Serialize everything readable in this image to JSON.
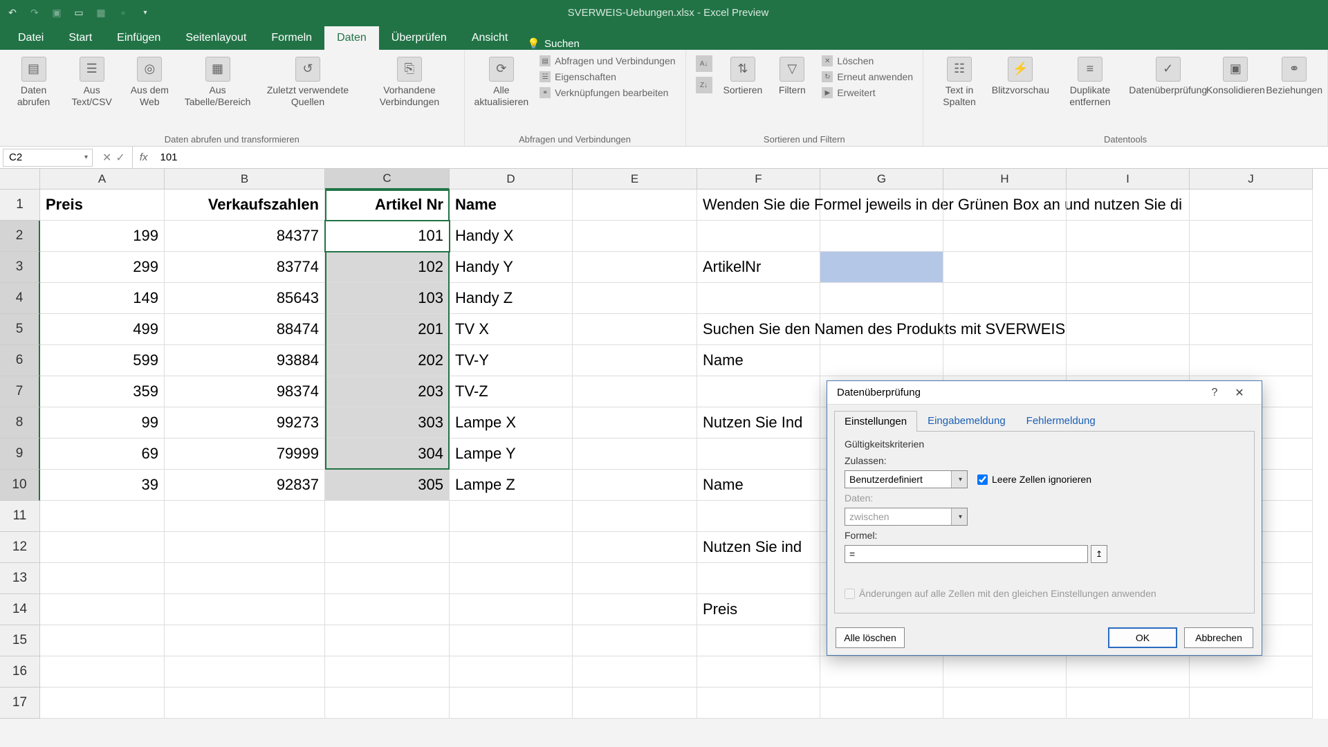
{
  "titlebar": {
    "title": "SVERWEIS-Uebungen.xlsx - Excel Preview"
  },
  "tabs": {
    "items": [
      "Datei",
      "Start",
      "Einfügen",
      "Seitenlayout",
      "Formeln",
      "Daten",
      "Überprüfen",
      "Ansicht"
    ],
    "active": "Daten",
    "search_placeholder": "Suchen"
  },
  "ribbon": {
    "group1": {
      "label": "Daten abrufen und transformieren",
      "btn1": "Daten abrufen",
      "btn2": "Aus Text/CSV",
      "btn3": "Aus dem Web",
      "btn4": "Aus Tabelle/Bereich",
      "btn5": "Zuletzt verwendete Quellen",
      "btn6": "Vorhandene Verbindungen"
    },
    "group2": {
      "label": "Abfragen und Verbindungen",
      "btn1": "Alle aktualisieren",
      "s1": "Abfragen und Verbindungen",
      "s2": "Eigenschaften",
      "s3": "Verknüpfungen bearbeiten"
    },
    "group3": {
      "label": "Sortieren und Filtern",
      "btn1": "Sortieren",
      "btn2": "Filtern",
      "s1": "Löschen",
      "s2": "Erneut anwenden",
      "s3": "Erweitert"
    },
    "group4": {
      "label": "Datentools",
      "btn1": "Text in Spalten",
      "btn2": "Blitzvorschau",
      "btn3": "Duplikate entfernen",
      "btn4": "Datenüberprüfung",
      "btn5": "Konsolidieren",
      "btn6": "Beziehungen"
    }
  },
  "formula_bar": {
    "name_box": "C2",
    "formula": "101"
  },
  "columns": [
    "A",
    "B",
    "C",
    "D",
    "E",
    "F",
    "G",
    "H",
    "I",
    "J"
  ],
  "sheet": {
    "headers": {
      "A": "Preis",
      "B": "Verkaufszahlen",
      "C": "Artikel Nr",
      "D": "Name"
    },
    "rows": [
      {
        "A": "199",
        "B": "84377",
        "C": "101",
        "D": "Handy X"
      },
      {
        "A": "299",
        "B": "83774",
        "C": "102",
        "D": "Handy Y"
      },
      {
        "A": "149",
        "B": "85643",
        "C": "103",
        "D": "Handy Z"
      },
      {
        "A": "499",
        "B": "88474",
        "C": "201",
        "D": "TV X"
      },
      {
        "A": "599",
        "B": "93884",
        "C": "202",
        "D": "TV-Y"
      },
      {
        "A": "359",
        "B": "98374",
        "C": "203",
        "D": "TV-Z"
      },
      {
        "A": "99",
        "B": "99273",
        "C": "303",
        "D": "Lampe X"
      },
      {
        "A": "69",
        "B": "79999",
        "C": "304",
        "D": "Lampe Y"
      },
      {
        "A": "39",
        "B": "92837",
        "C": "305",
        "D": "Lampe Z"
      }
    ],
    "fcol": {
      "1": "Wenden Sie die Formel jeweils in der Grünen Box an und nutzen Sie di",
      "3": "ArtikelNr",
      "5": "Suchen Sie den Namen des Produkts mit SVERWEIS",
      "6": "Name",
      "8": "Nutzen Sie Ind",
      "10": "Name",
      "12": "Nutzen Sie ind",
      "14": "Preis"
    }
  },
  "dialog": {
    "title": "Datenüberprüfung",
    "tabs": [
      "Einstellungen",
      "Eingabemeldung",
      "Fehlermeldung"
    ],
    "group_label": "Gültigkeitskriterien",
    "zulassen_label": "Zulassen:",
    "zulassen_value": "Benutzerdefiniert",
    "ignore_blank": "Leere Zellen ignorieren",
    "daten_label": "Daten:",
    "daten_value": "zwischen",
    "formel_label": "Formel:",
    "formel_value": "=",
    "apply_all": "Änderungen auf alle Zellen mit den gleichen Einstellungen anwenden",
    "clear_all": "Alle löschen",
    "ok": "OK",
    "cancel": "Abbrechen"
  }
}
